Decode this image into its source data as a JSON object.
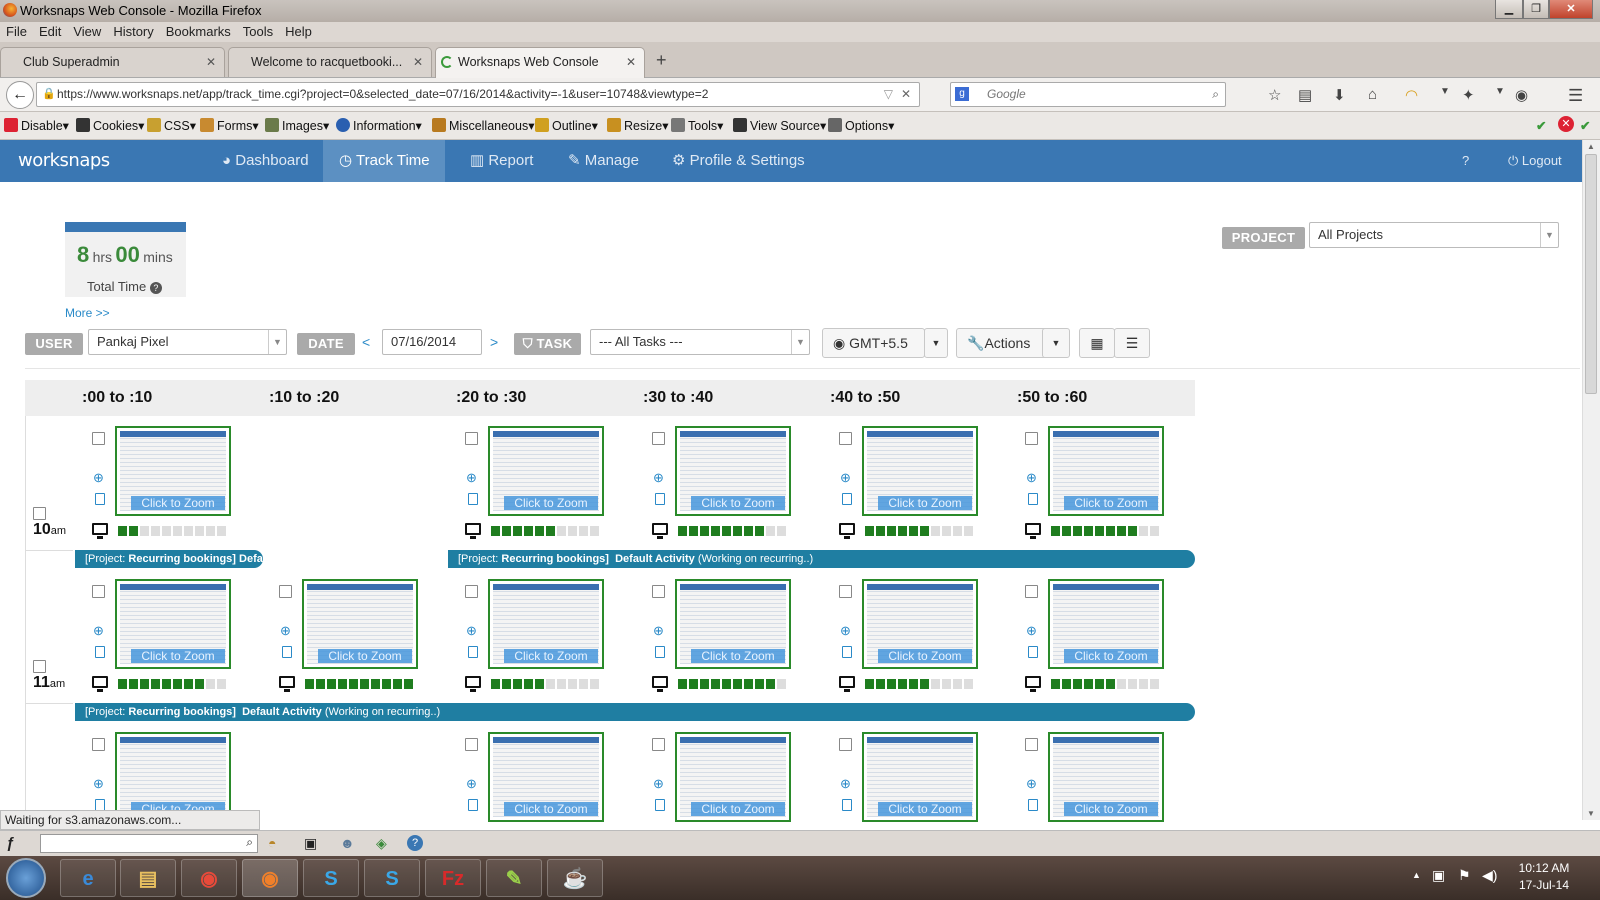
{
  "window": {
    "title": "Worksnaps Web Console - Mozilla Firefox",
    "minimize": "▁",
    "maximize": "❐",
    "close": "✕"
  },
  "menu": [
    "File",
    "Edit",
    "View",
    "History",
    "Bookmarks",
    "Tools",
    "Help"
  ],
  "tabs": [
    {
      "label": "Club Superadmin"
    },
    {
      "label": "Welcome to racquetbooki..."
    },
    {
      "label": "Worksnaps Web Console"
    }
  ],
  "address": {
    "url": "https://www.worksnaps.net/app/track_time.cgi?project=0&selected_date=07/16/2014&activity=-1&user=10748&viewtype=2",
    "search_placeholder": "Google"
  },
  "devtoolbar": [
    "Disable▾",
    "Cookies▾",
    "CSS▾",
    "Forms▾",
    "Images▾",
    "Information▾",
    "Miscellaneous▾",
    "Outline▾",
    "Resize▾",
    "Tools▾",
    "View Source▾",
    "Options▾"
  ],
  "app": {
    "logo": "worksnaps",
    "nav": [
      "Dashboard",
      "Track Time",
      "Report",
      "Manage",
      "Profile & Settings"
    ],
    "help": "?",
    "logout": "Logout",
    "total": {
      "hrs": "8",
      "hrs_unit": "hrs",
      "mins": "00",
      "mins_unit": "mins",
      "label": "Total Time",
      "more": "More >>"
    },
    "project": {
      "label": "PROJECT",
      "value": "All Projects"
    },
    "filters": {
      "user_label": "USER",
      "user_value": "Pankaj Pixel",
      "date_label": "DATE",
      "date_value": "07/16/2014",
      "prev": "<",
      "next": ">",
      "task_label": "TASK",
      "task_value": "--- All Tasks ---",
      "timezone": "GMT+5.5",
      "actions": "Actions"
    },
    "columns": [
      ":00 to :10",
      ":10 to :20",
      ":20 to :30",
      ":30 to :40",
      ":40 to :50",
      ":50 to :60"
    ],
    "zoom_label": "Click to Zoom",
    "hours": [
      {
        "hour": "10",
        "suffix": "am",
        "activity": [
          2,
          null,
          6,
          8,
          6,
          8
        ]
      },
      {
        "hour": "11",
        "suffix": "am",
        "activity": [
          8,
          10,
          5,
          9,
          6,
          6
        ]
      }
    ],
    "taskbars": {
      "row1_left": {
        "project": "[Project: ",
        "project_name": "Recurring bookings]",
        "activity": "Default Activity",
        "note": ""
      },
      "row1_right": {
        "project": "[Project: ",
        "project_name": "Recurring bookings]",
        "activity": "Default Activity",
        "note": "(Working on recurring..)"
      },
      "row2": {
        "project": "[Project: ",
        "project_name": "Recurring bookings]",
        "activity": "Default Activity",
        "note": "(Working on recurring..)"
      }
    }
  },
  "status": "Waiting for s3.amazonaws.com...",
  "clock": {
    "time": "10:12 AM",
    "date": "17-Jul-14"
  }
}
